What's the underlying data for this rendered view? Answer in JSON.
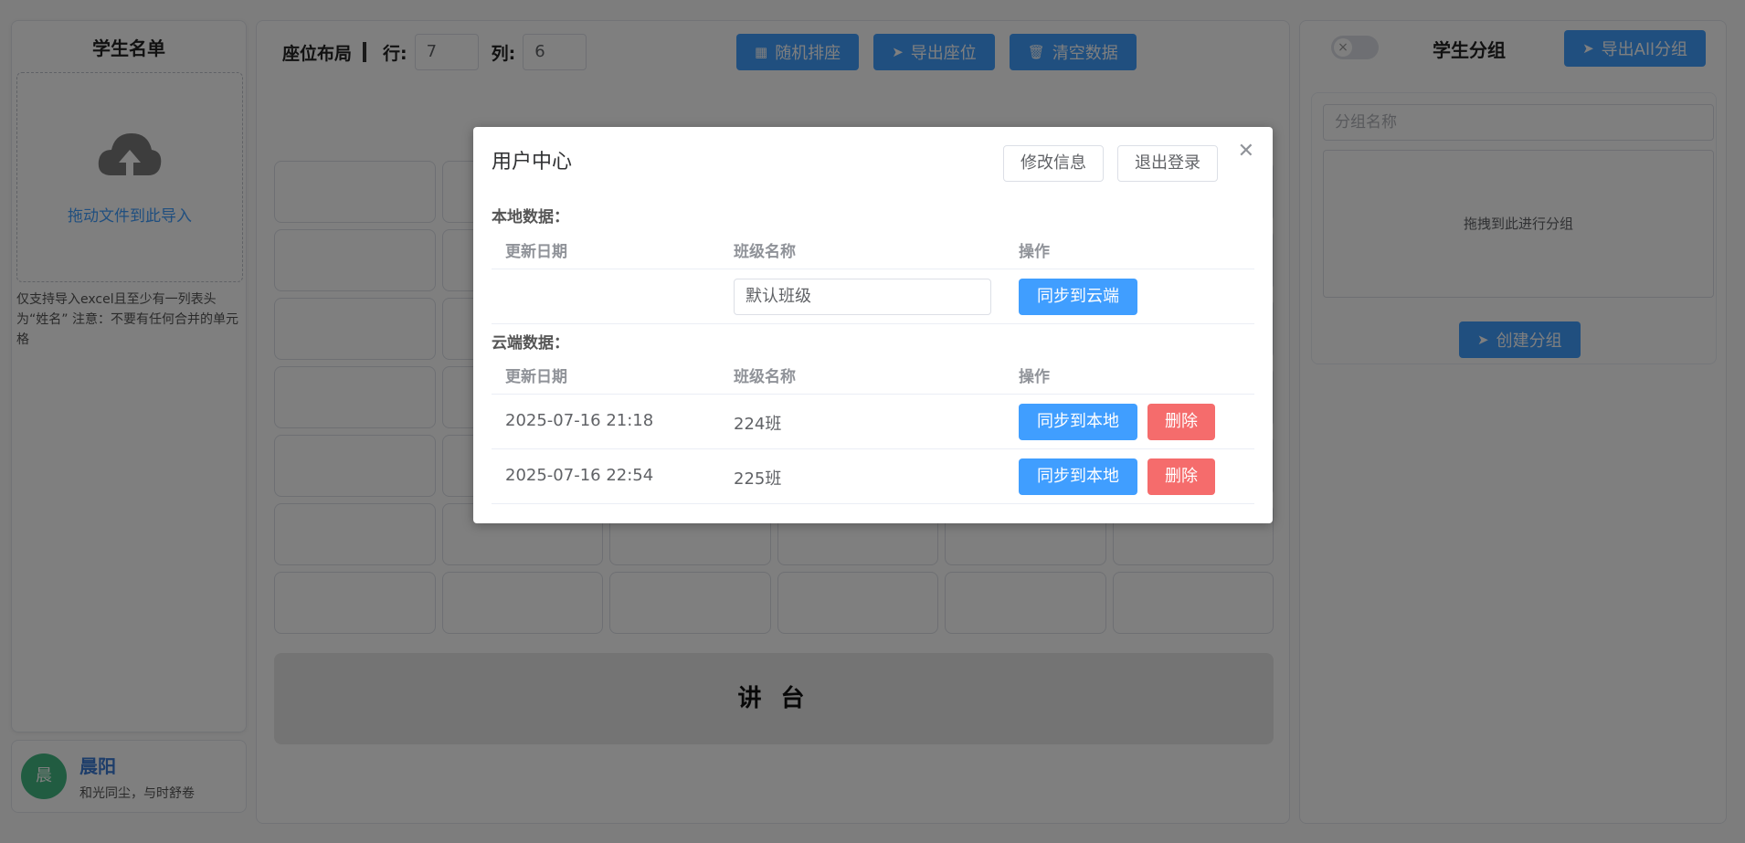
{
  "left": {
    "title": "学生名单",
    "upload_text": "拖动文件到此导入",
    "upload_tip": "仅支持导入excel且至少有一列表头为“姓名” 注意：不要有任何合并的单元格"
  },
  "user": {
    "avatar_char": "晨",
    "name": "晨阳",
    "motto": "和光同尘，与时舒卷"
  },
  "layout": {
    "title": "座位布局",
    "row_label": "行:",
    "row_value": "7",
    "col_label": "列:",
    "col_value": "6",
    "buttons": {
      "random": "随机排座",
      "export": "导出座位",
      "clear": "清空数据"
    },
    "podium": "讲 台"
  },
  "groups": {
    "title": "学生分组",
    "export_all": "导出All分组",
    "name_placeholder": "分组名称",
    "drop_text": "拖拽到此进行分组",
    "create": "创建分组"
  },
  "modal": {
    "title": "用户中心",
    "edit_button": "修改信息",
    "logout_button": "退出登录",
    "local_label": "本地数据：",
    "cloud_label": "云端数据：",
    "headers": {
      "date": "更新日期",
      "class": "班级名称",
      "action": "操作"
    },
    "local_row": {
      "date": "",
      "class_value": "默认班级",
      "sync_cloud": "同步到云端"
    },
    "cloud_rows": [
      {
        "date": "2025-07-16 21:18",
        "class": "224班",
        "sync_local": "同步到本地",
        "delete": "删除"
      },
      {
        "date": "2025-07-16 22:54",
        "class": "225班",
        "sync_local": "同步到本地",
        "delete": "删除"
      }
    ]
  },
  "colors": {
    "primary": "#409eff",
    "danger": "#f56c6c",
    "avatar": "#42b983",
    "overlay": "rgba(0,0,0,0.5)"
  }
}
